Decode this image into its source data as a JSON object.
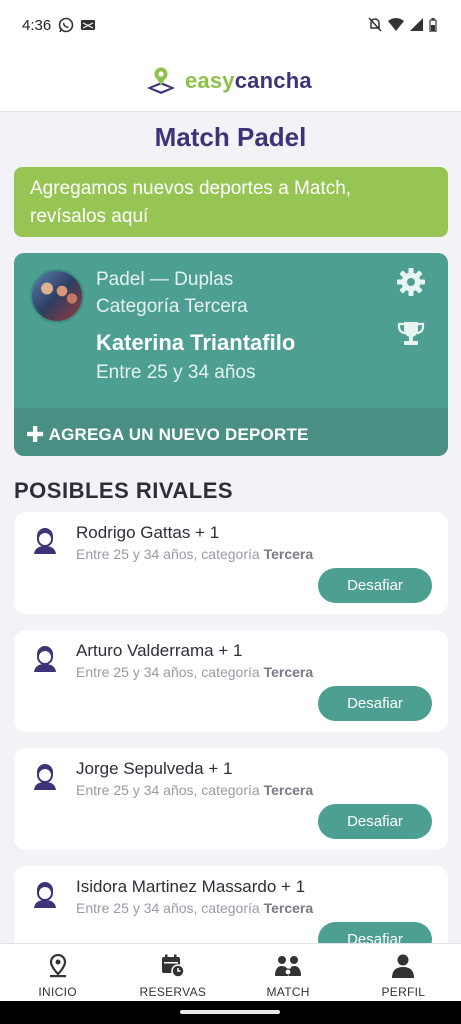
{
  "status": {
    "time": "4:36"
  },
  "logo": {
    "part1": "easy",
    "part2": "cancha"
  },
  "page_title": "Match Padel",
  "banner": {
    "text": "Agregamos nuevos deportes a Match, revísalos aquí"
  },
  "sport_card": {
    "line1": "Padel —  Duplas",
    "line2": "Categoría Tercera",
    "name": "Katerina Triantafilo",
    "age": "Entre 25 y 34 años",
    "add_label": "AGREGA UN NUEVO DEPORTE"
  },
  "section_title": "POSIBLES RIVALES",
  "rivals": [
    {
      "name": "Rodrigo Gattas + 1",
      "meta": "Entre 25 y 34 años,  categoría ",
      "category": "Tercera",
      "button": "Desafiar"
    },
    {
      "name": "Arturo Valderrama + 1",
      "meta": "Entre 25 y 34 años,  categoría ",
      "category": "Tercera",
      "button": "Desafiar"
    },
    {
      "name": "Jorge Sepulveda + 1",
      "meta": "Entre 25 y 34 años,  categoría ",
      "category": "Tercera",
      "button": "Desafiar"
    },
    {
      "name": "Isidora Martinez Massardo + 1",
      "meta": "Entre 25 y 34 años,  categoría ",
      "category": "Tercera",
      "button": "Desafiar"
    }
  ],
  "nav": [
    {
      "label": "INICIO",
      "icon": "location-pin-icon"
    },
    {
      "label": "RESERVAS",
      "icon": "calendar-clock-icon"
    },
    {
      "label": "MATCH",
      "icon": "players-icon"
    },
    {
      "label": "PERFIL",
      "icon": "person-icon"
    }
  ],
  "colors": {
    "brand_purple": "#3d3477",
    "brand_green": "#97c554",
    "teal": "#4c9f91"
  }
}
